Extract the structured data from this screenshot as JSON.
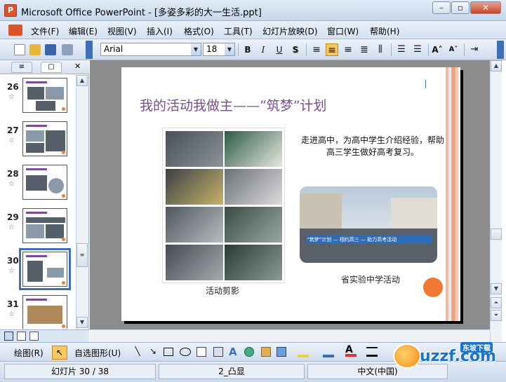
{
  "window": {
    "title": "Microsoft Office PowerPoint - [多姿多彩的大一生活.ppt]",
    "minimize": "–",
    "restore": "▫",
    "close": "✕"
  },
  "menu": [
    "文件(F)",
    "编辑(E)",
    "视图(V)",
    "插入(I)",
    "格式(O)",
    "工具(T)",
    "幻灯片放映(D)",
    "窗口(W)",
    "帮助(H)"
  ],
  "toolbar": {
    "font_name": "Arial",
    "font_size": "18",
    "bold": "B",
    "italic": "I",
    "underline": "U",
    "shadow": "S",
    "grow_font": "A˄",
    "shrink_font": "A˅"
  },
  "left_pane": {
    "tabs": [
      "≡",
      "▢"
    ],
    "close": "✕",
    "slides": [
      {
        "num": "26"
      },
      {
        "num": "27"
      },
      {
        "num": "28"
      },
      {
        "num": "29"
      },
      {
        "num": "30",
        "selected": true
      },
      {
        "num": "31"
      }
    ]
  },
  "slide": {
    "title": "我的活动我做主——“筑梦”计划",
    "description": "走进高中，为高中学生介绍经验，帮助高三学生做好高考复习。",
    "caption_left": "活动剪影",
    "caption_right": "省实验中学活动",
    "banner_text": "“筑梦”计划 — 相约高三 — 助力高考活动"
  },
  "drawbar": {
    "draw": "绘图(R)",
    "autoshapes": "自选图形(U)"
  },
  "status": {
    "slide_count": "幻灯片 30 / 38",
    "design": "2_凸显",
    "language": "中文(中国)"
  },
  "watermark": {
    "brand": "uzzf.com",
    "tag": "东坡下载"
  },
  "colors": {
    "title_purple": "#7b4c93",
    "accent_orange": "#f07a33",
    "selection_blue": "#3d6fb7"
  }
}
